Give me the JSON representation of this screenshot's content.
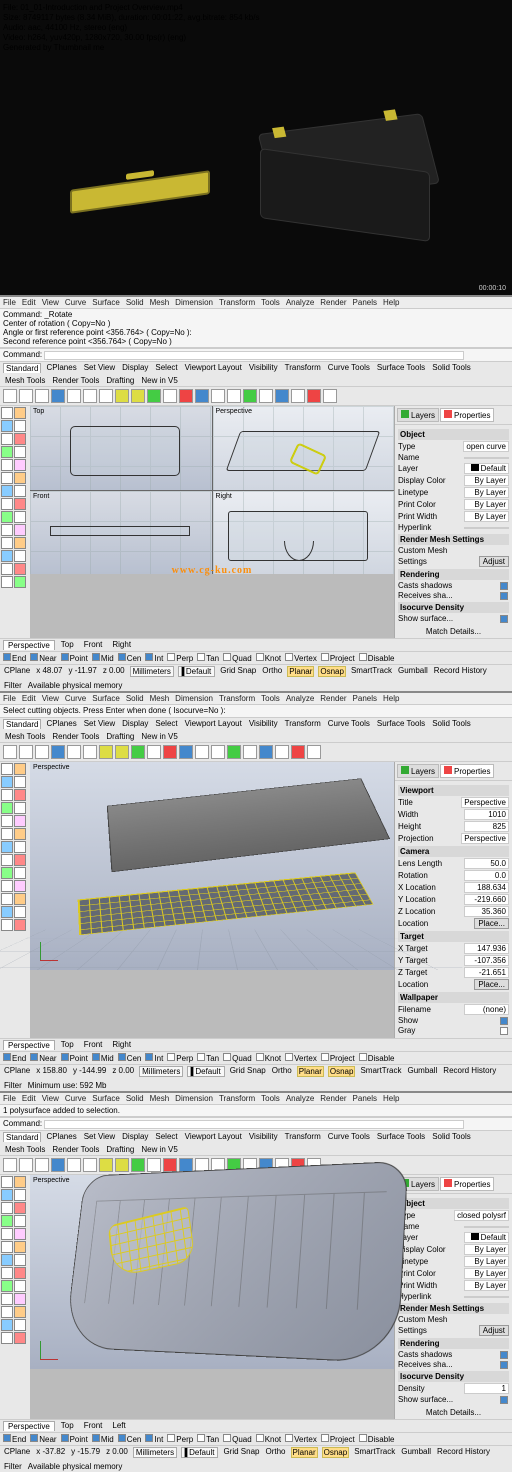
{
  "video": {
    "file": "File: 01_01-Introduction and Project Overview.mp4",
    "size": "Size: 8749117 bytes (8.34 MiB), duration: 00:01:22, avg.bitrate: 854 kb/s",
    "audio": "Audio: aac, 44100 Hz, stereo (eng)",
    "videoline": "Video: h264, yuv420p, 1280x720, 30.00 fps(r) (eng)",
    "gen": "Generated by Thumbnail me",
    "timer": "00:00:10"
  },
  "menu": [
    "File",
    "Edit",
    "View",
    "Curve",
    "Surface",
    "Solid",
    "Mesh",
    "Dimension",
    "Transform",
    "Tools",
    "Analyze",
    "Render",
    "Panels",
    "Help"
  ],
  "cmd1": {
    "l1": "Command: _Rotate",
    "l2": "Center of rotation ( Copy=No )",
    "l3": "Angle or first reference point <356.764> ( Copy=No ):",
    "l4": "Second reference point <356.764> ( Copy=No )",
    "prompt": "Command:"
  },
  "tabs": [
    "Standard",
    "CPlanes",
    "Set View",
    "Display",
    "Select",
    "Viewport Layout",
    "Visibility",
    "Transform",
    "Curve Tools",
    "Surface Tools",
    "Solid Tools",
    "Mesh Tools",
    "Render Tools",
    "Drafting",
    "New in V5"
  ],
  "viewnames": {
    "top": "Top",
    "persp": "Perspective",
    "front": "Front",
    "right": "Right",
    "left": "Left"
  },
  "panel": {
    "tab_layers": "Layers",
    "tab_props": "Properties",
    "object": "Object",
    "viewport": "Viewport",
    "camera": "Camera",
    "target": "Target",
    "wallpaper": "Wallpaper",
    "type": "Type",
    "name": "Name",
    "layer": "Layer",
    "disp_color": "Display Color",
    "linetype": "Linetype",
    "print_color": "Print Color",
    "print_width": "Print Width",
    "hyperlink": "Hyperlink",
    "rms": "Render Mesh Settings",
    "custom_mesh": "Custom Mesh",
    "settings": "Settings",
    "adjust": "Adjust",
    "rendering": "Rendering",
    "casts": "Casts shadows",
    "receives": "Receives sha...",
    "iso": "Isocurve Density",
    "density": "Density",
    "show_surface": "Show surface...",
    "match": "Match",
    "details": "Details...",
    "by_layer": "By Layer",
    "default": "Default",
    "open_curve": "open curve",
    "closed_poly": "closed polysrf",
    "width": "Width",
    "height": "Height",
    "title": "Title",
    "projection": "Projection",
    "lens": "Lens Length",
    "rotation": "Rotation",
    "xloc": "X Location",
    "yloc": "Y Location",
    "zloc": "Z Location",
    "xtgt": "X Target",
    "ytgt": "Y Target",
    "ztgt": "Z Target",
    "location": "Location",
    "place": "Place...",
    "filename": "Filename",
    "show": "Show",
    "gray": "Gray",
    "persp_val": "Perspective",
    "none": "(none)",
    "v_width": "1010",
    "v_height": "825",
    "v_lens": "50.0",
    "v_rot": "0.0",
    "v_x": "188.634",
    "v_y": "-219.660",
    "v_z": "35.360",
    "t_x": "147.936",
    "t_y": "-107.356",
    "t_z": "-21.651",
    "den": "1"
  },
  "vptabs1": [
    "Perspective",
    "Top",
    "Front",
    "Right"
  ],
  "vptabs3": [
    "Perspective",
    "Top",
    "Front",
    "Left"
  ],
  "check": {
    "End": "End",
    "Near": "Near",
    "Point": "Point",
    "Mid": "Mid",
    "Cen": "Cen",
    "Int": "Int",
    "Perp": "Perp",
    "Tan": "Tan",
    "Quad": "Quad",
    "Knot": "Knot",
    "Vertex": "Vertex",
    "Project": "Project",
    "Disable": "Disable"
  },
  "status": {
    "cplane": "CPlane",
    "x": "x 48.07",
    "y": "y -11.97",
    "z": "z 0.00",
    "mm": "Millimeters",
    "default": "Default",
    "grid": "Grid Snap",
    "ortho": "Ortho",
    "planar": "Planar",
    "osnap": "Osnap",
    "smart": "SmartTrack",
    "gumball": "Gumball",
    "record": "Record History",
    "filter": "Filter",
    "mem": "Available physical memory",
    "x2": "x 158.80",
    "y2": "y -144.99",
    "z2": "z 0.00",
    "mem2": "Minimum use: 592 Mb",
    "x3": "x -37.82",
    "y3": "y -15.79",
    "z3": "z 0.00"
  },
  "cmd2": {
    "l1": "Select cutting objects. Press Enter when done ( Isocurve=No ):"
  },
  "cmd3": {
    "l1": "1 polysurface added to selection.",
    "prompt": "Command:"
  },
  "wm": "www.cg-ku.com"
}
